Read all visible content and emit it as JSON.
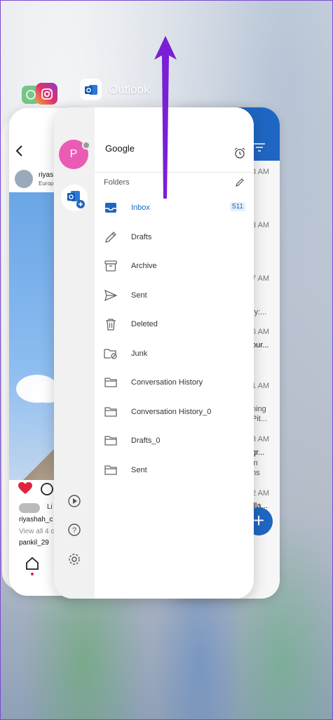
{
  "app_switcher": {
    "current_app_title": "Outlook",
    "apps": [
      "whatsapp-icon",
      "instagram-icon",
      "outlook-icon"
    ]
  },
  "instagram_card": {
    "username_short": "riyas",
    "location_short": "Europ",
    "liker_text": "Li",
    "caption_user": "riyashah_c",
    "view_all": "View all 4 c",
    "commenter": "pankil_29"
  },
  "mail_list_card": {
    "times": [
      "8 AM",
      "8 AM",
      "7 AM",
      "6 AM",
      "1 AM",
      "3 AM",
      "2 AM"
    ],
    "snippets": [
      "ry:...",
      "our...",
      "ning",
      "Pit...",
      "gr...",
      "in",
      "ns",
      "illa..."
    ]
  },
  "outlook": {
    "account_initial": "P",
    "account_name": "Google",
    "folders_label": "Folders",
    "folders": [
      {
        "label": "Inbox",
        "icon": "inbox-icon",
        "count": "511",
        "active": true
      },
      {
        "label": "Drafts",
        "icon": "pencil-icon"
      },
      {
        "label": "Archive",
        "icon": "archive-icon"
      },
      {
        "label": "Sent",
        "icon": "send-icon"
      },
      {
        "label": "Deleted",
        "icon": "trash-icon"
      },
      {
        "label": "Junk",
        "icon": "junk-folder-icon"
      },
      {
        "label": "Conversation History",
        "icon": "folder-icon"
      },
      {
        "label": "Conversation History_0",
        "icon": "folder-icon"
      },
      {
        "label": "Drafts_0",
        "icon": "folder-icon"
      },
      {
        "label": "Sent",
        "icon": "folder-icon"
      }
    ]
  },
  "colors": {
    "accent": "#1f66c2",
    "avatar": "#ea5cb3",
    "annotation_arrow": "#7a1fd6"
  }
}
